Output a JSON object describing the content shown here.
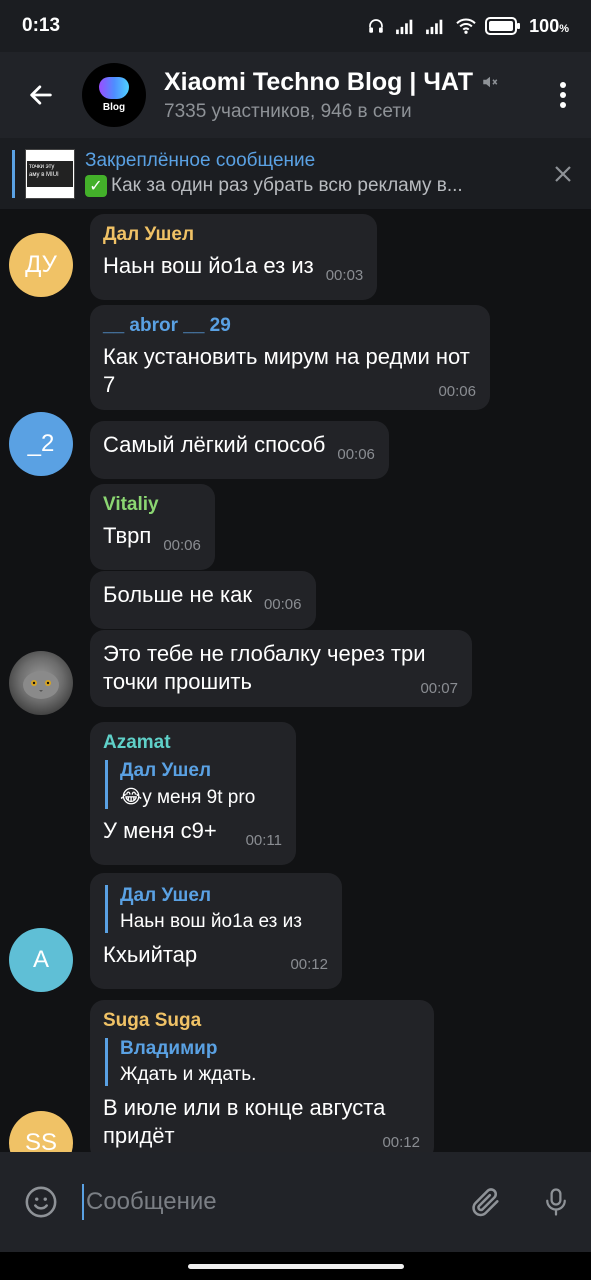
{
  "status": {
    "time": "0:13",
    "battery": "100",
    "battery_unit": "%"
  },
  "header": {
    "title": "Xiaomi Techno Blog | ЧАТ",
    "subtitle": "7335 участников, 946 в сети",
    "avatar_text": "Blog"
  },
  "pinned": {
    "title": "Закреплённое сообщение",
    "text": "Как за один раз убрать всю рекламу в...",
    "thumb_text": "точки эту\nаму в MIUI"
  },
  "messages": [
    {
      "sender": "Дал Ушел",
      "text": "Наьн вош йо1а ез из",
      "time": "00:03"
    },
    {
      "sender": "__ abror __ 29",
      "text": "Как установить мирум на редми нот 7",
      "time": "00:06"
    },
    {
      "text": "Самый лёгкий способ",
      "time": "00:06"
    },
    {
      "sender": "Vitaliy",
      "text": "Тврп",
      "time": "00:06"
    },
    {
      "text": "Больше не как",
      "time": "00:06"
    },
    {
      "text": "Это тебе не глобалку через три точки прошить",
      "time": "00:07"
    },
    {
      "sender": "Azamat",
      "reply_name": "Дал Ушел",
      "reply_text": "у меня 9t pro",
      "reply_emoji": "😂",
      "text": "У меня с9+",
      "time": "00:11"
    },
    {
      "reply_name": "Дал Ушел",
      "reply_text": "Наьн вош йо1а ез из",
      "text": "Кхьийтар",
      "time": "00:12"
    },
    {
      "sender": "Suga Suga",
      "reply_name": "Владимир",
      "reply_text": "Ждать и ждать.",
      "text": "В июле или в конце августа придёт",
      "time": "00:12"
    }
  ],
  "avatars": [
    {
      "initials": "ДУ",
      "color": "#f0c266"
    },
    {
      "initials": "_2",
      "color": "#5aa1e3"
    },
    {
      "initials": "А",
      "color": "#5fbfd6"
    },
    {
      "initials": "SS",
      "color": "#f0c266"
    }
  ],
  "sender_colors": {
    "dal": "#f0c266",
    "abror": "#5aa1e3",
    "vitaliy": "#8bd672",
    "azamat": "#5fd0c8",
    "suga": "#f0c266"
  },
  "composer": {
    "placeholder": "Сообщение"
  }
}
